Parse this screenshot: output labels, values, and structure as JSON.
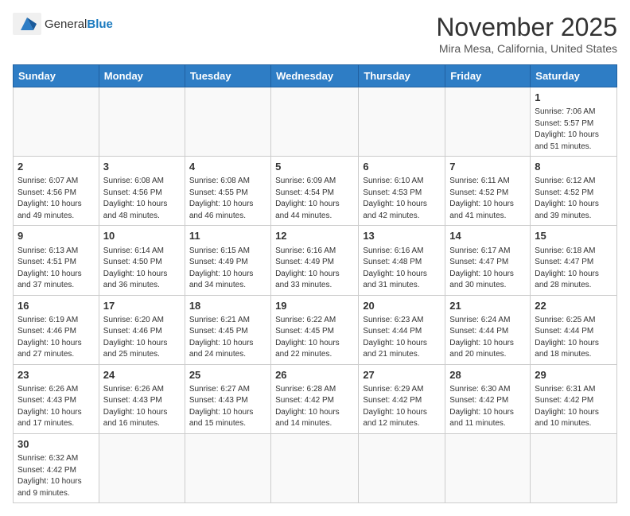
{
  "logo": {
    "text_general": "General",
    "text_blue": "Blue"
  },
  "title": "November 2025",
  "location": "Mira Mesa, California, United States",
  "weekdays": [
    "Sunday",
    "Monday",
    "Tuesday",
    "Wednesday",
    "Thursday",
    "Friday",
    "Saturday"
  ],
  "weeks": [
    [
      {
        "day": "",
        "info": ""
      },
      {
        "day": "",
        "info": ""
      },
      {
        "day": "",
        "info": ""
      },
      {
        "day": "",
        "info": ""
      },
      {
        "day": "",
        "info": ""
      },
      {
        "day": "",
        "info": ""
      },
      {
        "day": "1",
        "info": "Sunrise: 7:06 AM\nSunset: 5:57 PM\nDaylight: 10 hours and 51 minutes."
      }
    ],
    [
      {
        "day": "2",
        "info": "Sunrise: 6:07 AM\nSunset: 4:56 PM\nDaylight: 10 hours and 49 minutes."
      },
      {
        "day": "3",
        "info": "Sunrise: 6:08 AM\nSunset: 4:56 PM\nDaylight: 10 hours and 48 minutes."
      },
      {
        "day": "4",
        "info": "Sunrise: 6:08 AM\nSunset: 4:55 PM\nDaylight: 10 hours and 46 minutes."
      },
      {
        "day": "5",
        "info": "Sunrise: 6:09 AM\nSunset: 4:54 PM\nDaylight: 10 hours and 44 minutes."
      },
      {
        "day": "6",
        "info": "Sunrise: 6:10 AM\nSunset: 4:53 PM\nDaylight: 10 hours and 42 minutes."
      },
      {
        "day": "7",
        "info": "Sunrise: 6:11 AM\nSunset: 4:52 PM\nDaylight: 10 hours and 41 minutes."
      },
      {
        "day": "8",
        "info": "Sunrise: 6:12 AM\nSunset: 4:52 PM\nDaylight: 10 hours and 39 minutes."
      }
    ],
    [
      {
        "day": "9",
        "info": "Sunrise: 6:13 AM\nSunset: 4:51 PM\nDaylight: 10 hours and 37 minutes."
      },
      {
        "day": "10",
        "info": "Sunrise: 6:14 AM\nSunset: 4:50 PM\nDaylight: 10 hours and 36 minutes."
      },
      {
        "day": "11",
        "info": "Sunrise: 6:15 AM\nSunset: 4:49 PM\nDaylight: 10 hours and 34 minutes."
      },
      {
        "day": "12",
        "info": "Sunrise: 6:16 AM\nSunset: 4:49 PM\nDaylight: 10 hours and 33 minutes."
      },
      {
        "day": "13",
        "info": "Sunrise: 6:16 AM\nSunset: 4:48 PM\nDaylight: 10 hours and 31 minutes."
      },
      {
        "day": "14",
        "info": "Sunrise: 6:17 AM\nSunset: 4:47 PM\nDaylight: 10 hours and 30 minutes."
      },
      {
        "day": "15",
        "info": "Sunrise: 6:18 AM\nSunset: 4:47 PM\nDaylight: 10 hours and 28 minutes."
      }
    ],
    [
      {
        "day": "16",
        "info": "Sunrise: 6:19 AM\nSunset: 4:46 PM\nDaylight: 10 hours and 27 minutes."
      },
      {
        "day": "17",
        "info": "Sunrise: 6:20 AM\nSunset: 4:46 PM\nDaylight: 10 hours and 25 minutes."
      },
      {
        "day": "18",
        "info": "Sunrise: 6:21 AM\nSunset: 4:45 PM\nDaylight: 10 hours and 24 minutes."
      },
      {
        "day": "19",
        "info": "Sunrise: 6:22 AM\nSunset: 4:45 PM\nDaylight: 10 hours and 22 minutes."
      },
      {
        "day": "20",
        "info": "Sunrise: 6:23 AM\nSunset: 4:44 PM\nDaylight: 10 hours and 21 minutes."
      },
      {
        "day": "21",
        "info": "Sunrise: 6:24 AM\nSunset: 4:44 PM\nDaylight: 10 hours and 20 minutes."
      },
      {
        "day": "22",
        "info": "Sunrise: 6:25 AM\nSunset: 4:44 PM\nDaylight: 10 hours and 18 minutes."
      }
    ],
    [
      {
        "day": "23",
        "info": "Sunrise: 6:26 AM\nSunset: 4:43 PM\nDaylight: 10 hours and 17 minutes."
      },
      {
        "day": "24",
        "info": "Sunrise: 6:26 AM\nSunset: 4:43 PM\nDaylight: 10 hours and 16 minutes."
      },
      {
        "day": "25",
        "info": "Sunrise: 6:27 AM\nSunset: 4:43 PM\nDaylight: 10 hours and 15 minutes."
      },
      {
        "day": "26",
        "info": "Sunrise: 6:28 AM\nSunset: 4:42 PM\nDaylight: 10 hours and 14 minutes."
      },
      {
        "day": "27",
        "info": "Sunrise: 6:29 AM\nSunset: 4:42 PM\nDaylight: 10 hours and 12 minutes."
      },
      {
        "day": "28",
        "info": "Sunrise: 6:30 AM\nSunset: 4:42 PM\nDaylight: 10 hours and 11 minutes."
      },
      {
        "day": "29",
        "info": "Sunrise: 6:31 AM\nSunset: 4:42 PM\nDaylight: 10 hours and 10 minutes."
      }
    ],
    [
      {
        "day": "30",
        "info": "Sunrise: 6:32 AM\nSunset: 4:42 PM\nDaylight: 10 hours and 9 minutes."
      },
      {
        "day": "",
        "info": ""
      },
      {
        "day": "",
        "info": ""
      },
      {
        "day": "",
        "info": ""
      },
      {
        "day": "",
        "info": ""
      },
      {
        "day": "",
        "info": ""
      },
      {
        "day": "",
        "info": ""
      }
    ]
  ]
}
